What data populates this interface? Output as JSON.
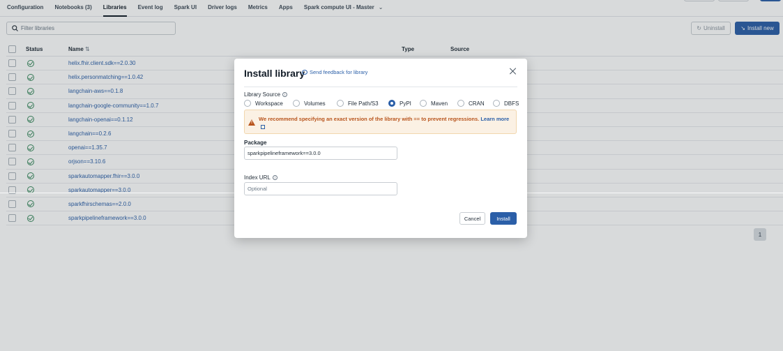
{
  "tabs": [
    {
      "label": "Configuration"
    },
    {
      "label": "Notebooks (3)"
    },
    {
      "label": "Libraries",
      "active": true
    },
    {
      "label": "Event log"
    },
    {
      "label": "Spark UI"
    },
    {
      "label": "Driver logs"
    },
    {
      "label": "Metrics"
    },
    {
      "label": "Apps"
    },
    {
      "label": "Spark compute UI - Master"
    }
  ],
  "toolbar": {
    "filter_placeholder": "Filter libraries",
    "uninstall_label": "Uninstall",
    "install_new_label": "Install new"
  },
  "table": {
    "headers": {
      "status": "Status",
      "name": "Name",
      "type": "Type",
      "source": "Source"
    },
    "rows": [
      "helix.fhir.client.sdk==2.0.30",
      "helix.personmatching==1.0.42",
      "langchain-aws==0.1.8",
      "langchain-google-community==1.0.7",
      "langchain-openai==0.1.12",
      "langchain==0.2.6",
      "openai==1.35.7",
      "orjson==3.10.6",
      "sparkautomapper.fhir==3.0.0",
      "sparkautomapper==3.0.0",
      "sparkfhirschemas==2.0.0",
      "sparkpipelineframework==3.0.0"
    ]
  },
  "pagination": {
    "current_page": "1"
  },
  "modal": {
    "title": "Install library",
    "feedback_link": "Send feedback for library",
    "library_source_label": "Library Source",
    "sources": [
      "Workspace",
      "Volumes",
      "File Path/S3",
      "PyPI",
      "Maven",
      "CRAN",
      "DBFS"
    ],
    "selected_source": "PyPI",
    "warning_text": "We recommend specifying an exact version of the library with == to prevent regressions.",
    "warning_link": "Learn more",
    "package_label": "Package",
    "package_value": "sparkpipelineframework==3.0.0",
    "index_url_label": "Index URL",
    "index_url_placeholder": "Optional",
    "cancel_label": "Cancel",
    "install_label": "Install"
  },
  "colors": {
    "primary": "#2b5fa8",
    "success": "#3a8a5e",
    "warning": "#b8541c",
    "warning_bg": "#fbf1e4"
  }
}
